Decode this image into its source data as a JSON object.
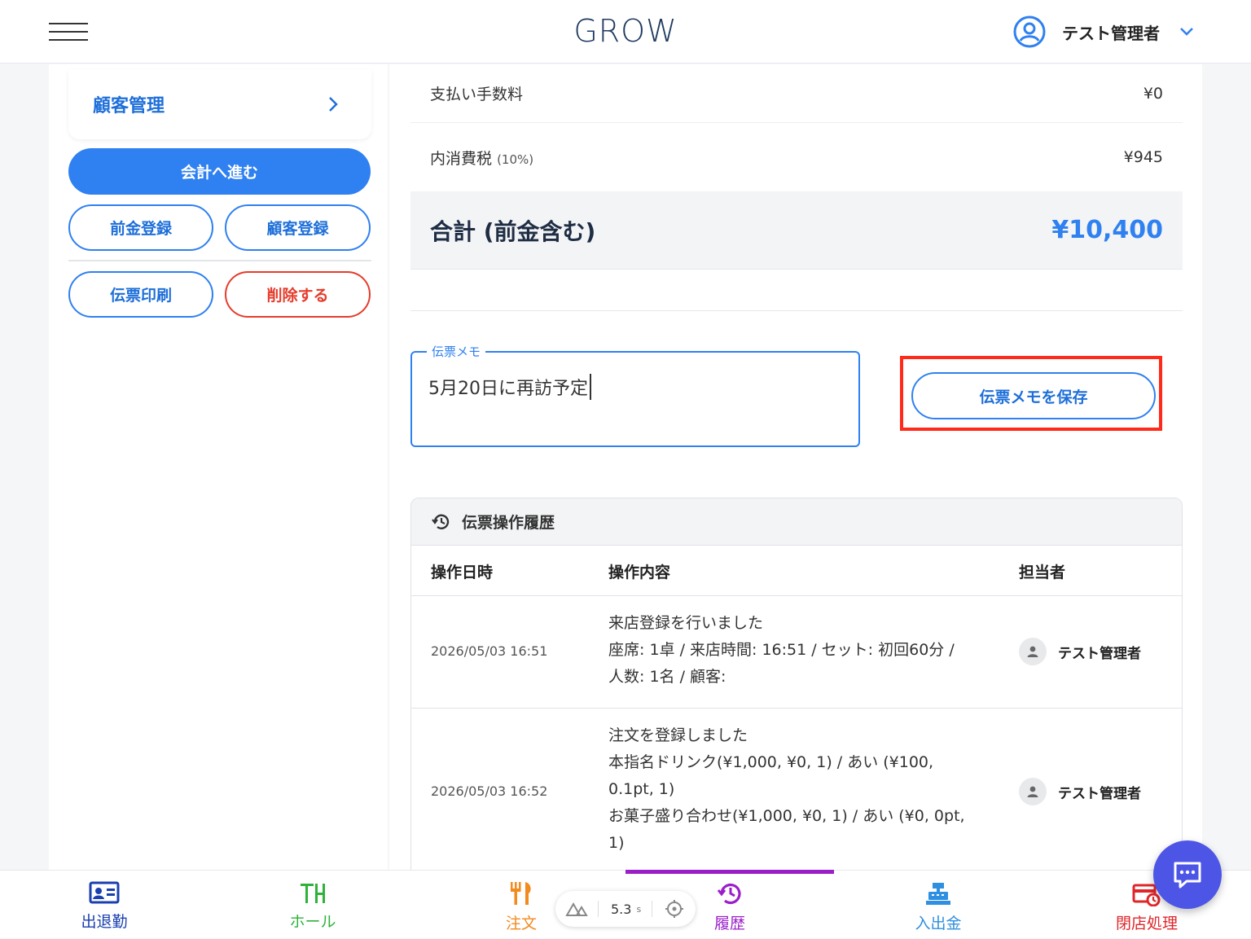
{
  "header": {
    "logo": "GROW",
    "user_name": "テスト管理者"
  },
  "left": {
    "customer_card": "顧客管理",
    "checkout_button": "会計へ進む",
    "advance_button": "前金登録",
    "customer_register_button": "顧客登録",
    "print_button": "伝票印刷",
    "delete_button": "削除する"
  },
  "summary": {
    "fee_label": "支払い手数料",
    "fee_value": "¥0",
    "tax_label": "内消費税",
    "tax_rate": "(10%)",
    "tax_value": "¥945",
    "total_label": "合計 (前金含む)",
    "total_value": "¥10,400"
  },
  "memo": {
    "label": "伝票メモ",
    "value": "5月20日に再訪予定",
    "save_button": "伝票メモを保存"
  },
  "history": {
    "title": "伝票操作履歴",
    "columns": [
      "操作日時",
      "操作内容",
      "担当者"
    ],
    "rows": [
      {
        "date": "2026/05/03 16:51",
        "lines": [
          "来店登録を行いました",
          "座席: 1卓 / 来店時間: 16:51 / セット: 初回60分 /",
          "人数: 1名 / 顧客:"
        ],
        "staff": "テスト管理者"
      },
      {
        "date": "2026/05/03 16:52",
        "lines": [
          "注文を登録しました",
          "本指名ドリンク(¥1,000, ¥0, 1) / あい (¥100,",
          "0.1pt, 1)",
          "お菓子盛り合わせ(¥1,000, ¥0, 1) / あい (¥0, 0pt,",
          "1)"
        ],
        "staff": "テスト管理者"
      }
    ]
  },
  "bottom_nav": [
    {
      "label": "出退勤",
      "color": "#1a3fb0",
      "icon": "id-card-icon"
    },
    {
      "label": "ホール",
      "color": "#2fb23a",
      "icon": "table-icon"
    },
    {
      "label": "注文",
      "color": "#f28a1e",
      "icon": "fork-knife-icon"
    },
    {
      "label": "履歴",
      "color": "#9b1fc9",
      "icon": "history-icon",
      "active": true
    },
    {
      "label": "入出金",
      "color": "#2f8fe0",
      "icon": "cash-register-icon"
    },
    {
      "label": "閉店処理",
      "color": "#e0262a",
      "icon": "store-close-icon"
    }
  ],
  "devtools": {
    "time": "5.3",
    "unit": "s"
  },
  "colors": {
    "accent": "#2f80f0",
    "danger": "#e53c2c",
    "highlight": "#ff2a1a"
  }
}
